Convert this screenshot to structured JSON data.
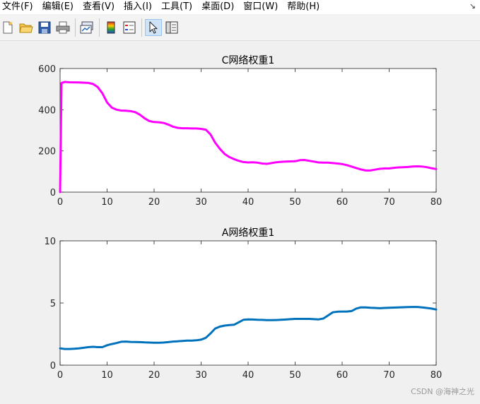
{
  "menubar": {
    "items": [
      "文件(F)",
      "编辑(E)",
      "查看(V)",
      "插入(I)",
      "工具(T)",
      "桌面(D)",
      "窗口(W)",
      "帮助(H)"
    ],
    "corner_arrow": "↘"
  },
  "toolbar": {
    "buttons": [
      "new-file-icon",
      "open-folder-icon",
      "save-icon",
      "print-icon",
      "link-plot-icon",
      "colorbar-icon",
      "legend-icon",
      "pointer-icon",
      "property-editor-icon"
    ]
  },
  "watermark": "CSDN @海神之光",
  "chart_data": [
    {
      "type": "line",
      "title": "C网络权重1",
      "xlim": [
        0,
        80
      ],
      "ylim": [
        0,
        600
      ],
      "xticks": [
        "0",
        "10",
        "20",
        "30",
        "40",
        "50",
        "60",
        "70",
        "80"
      ],
      "yticks": [
        "0",
        "200",
        "400",
        "600"
      ],
      "grid": false,
      "series": [
        {
          "color": "#ff00ff",
          "x": [
            0,
            0.3,
            1,
            2,
            4,
            6,
            7,
            8,
            9,
            10,
            11,
            12,
            13,
            14,
            15,
            16,
            17,
            18,
            19,
            20,
            21,
            22,
            23,
            24,
            25,
            26,
            27,
            28,
            29,
            30,
            31,
            32,
            33,
            34,
            35,
            36,
            37,
            38,
            39,
            40,
            41,
            42,
            43,
            44,
            45,
            46,
            47,
            48,
            49,
            50,
            51,
            52,
            53,
            54,
            55,
            56,
            57,
            58,
            59,
            60,
            61,
            62,
            63,
            64,
            65,
            66,
            67,
            68,
            69,
            70,
            71,
            72,
            73,
            74,
            75,
            76,
            77,
            78,
            79,
            80
          ],
          "y": [
            0,
            530,
            535,
            533,
            532,
            530,
            525,
            510,
            480,
            435,
            410,
            400,
            396,
            395,
            393,
            388,
            375,
            358,
            345,
            340,
            339,
            336,
            328,
            318,
            312,
            310,
            310,
            309,
            309,
            307,
            303,
            280,
            240,
            210,
            185,
            170,
            160,
            152,
            146,
            144,
            145,
            143,
            139,
            137,
            141,
            145,
            147,
            148,
            149,
            150,
            155,
            156,
            152,
            148,
            144,
            143,
            143,
            141,
            139,
            136,
            131,
            124,
            117,
            110,
            105,
            105,
            109,
            113,
            115,
            115,
            118,
            120,
            121,
            122,
            124,
            125,
            124,
            121,
            116,
            112
          ]
        }
      ]
    },
    {
      "type": "line",
      "title": "A网络权重1",
      "xlim": [
        0,
        80
      ],
      "ylim": [
        0,
        10
      ],
      "xticks": [
        "0",
        "10",
        "20",
        "30",
        "40",
        "50",
        "60",
        "70",
        "80"
      ],
      "yticks": [
        "0",
        "5",
        "10"
      ],
      "grid": false,
      "series": [
        {
          "color": "#0072bd",
          "x": [
            0,
            1,
            2,
            3,
            4,
            5,
            6,
            7,
            8,
            9,
            10,
            11,
            12,
            13,
            14,
            15,
            16,
            17,
            18,
            19,
            20,
            21,
            22,
            23,
            24,
            25,
            26,
            27,
            28,
            29,
            30,
            31,
            32,
            33,
            34,
            35,
            36,
            37,
            38,
            39,
            40,
            41,
            42,
            43,
            44,
            45,
            46,
            47,
            48,
            49,
            50,
            51,
            52,
            53,
            54,
            55,
            56,
            57,
            58,
            59,
            60,
            61,
            62,
            63,
            64,
            65,
            66,
            67,
            68,
            69,
            70,
            71,
            72,
            73,
            74,
            75,
            76,
            77,
            78,
            79,
            80
          ],
          "y": [
            1.35,
            1.3,
            1.3,
            1.32,
            1.35,
            1.4,
            1.45,
            1.48,
            1.45,
            1.45,
            1.6,
            1.7,
            1.78,
            1.88,
            1.9,
            1.87,
            1.86,
            1.85,
            1.83,
            1.82,
            1.8,
            1.8,
            1.82,
            1.85,
            1.9,
            1.92,
            1.95,
            1.97,
            1.98,
            2.0,
            2.05,
            2.2,
            2.55,
            2.95,
            3.1,
            3.18,
            3.22,
            3.25,
            3.45,
            3.65,
            3.68,
            3.67,
            3.65,
            3.64,
            3.62,
            3.62,
            3.63,
            3.65,
            3.67,
            3.7,
            3.72,
            3.72,
            3.72,
            3.72,
            3.7,
            3.68,
            3.75,
            4.0,
            4.25,
            4.3,
            4.31,
            4.31,
            4.35,
            4.55,
            4.65,
            4.65,
            4.62,
            4.6,
            4.58,
            4.6,
            4.62,
            4.63,
            4.64,
            4.66,
            4.67,
            4.68,
            4.68,
            4.65,
            4.6,
            4.55,
            4.48
          ]
        }
      ]
    }
  ]
}
